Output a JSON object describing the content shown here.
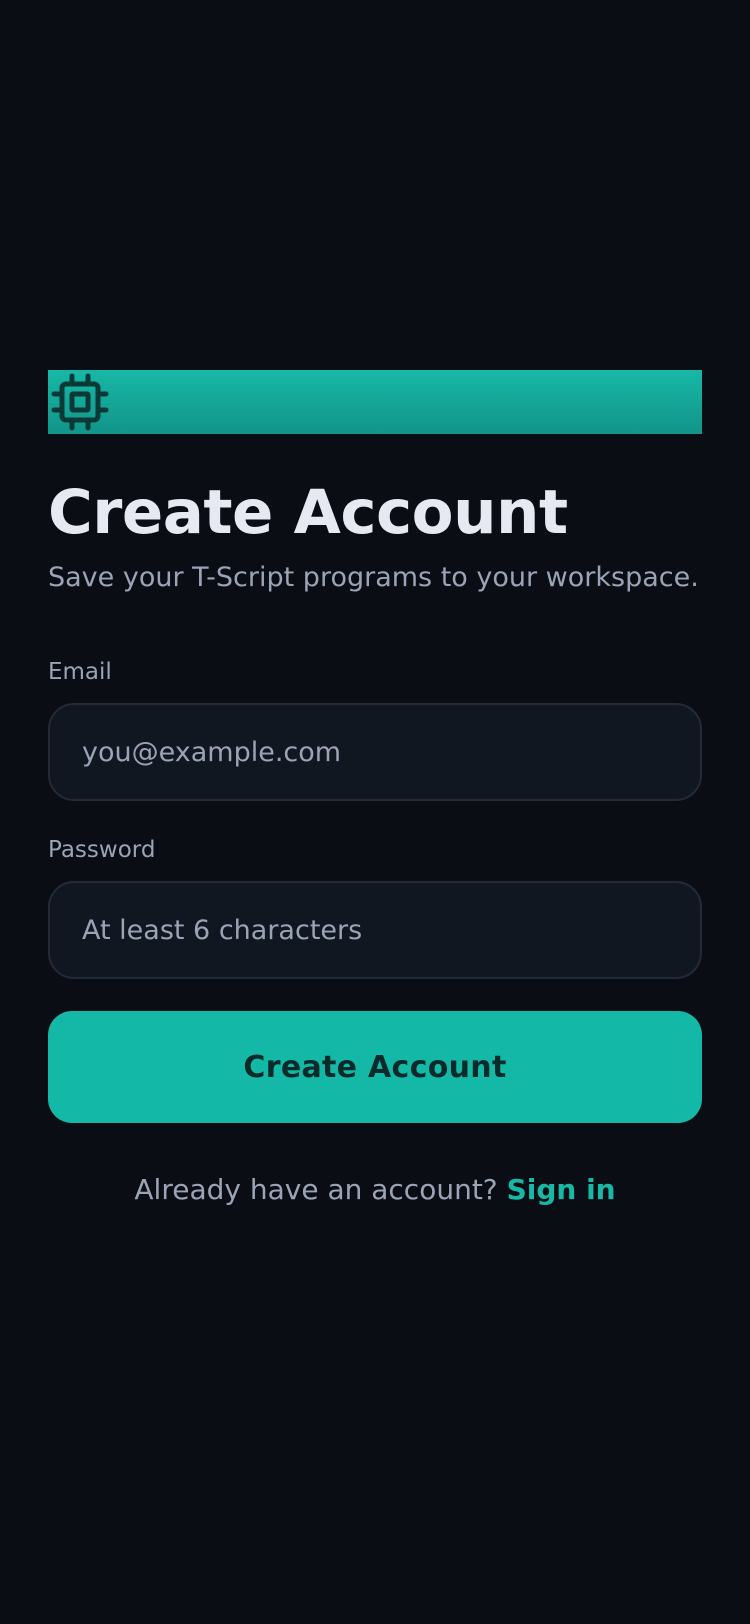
{
  "colors": {
    "background": "#0a0d14",
    "accent": "#14b8a6",
    "muted_text": "#9aa4b6",
    "heading_text": "#e6e9f2",
    "input_background": "#111721"
  },
  "brand": {
    "icon": "cpu-chip-icon"
  },
  "header": {
    "title": "Create Account",
    "subtitle": "Save your T-Script programs to your workspace."
  },
  "form": {
    "email": {
      "label": "Email",
      "placeholder": "you@example.com",
      "value": ""
    },
    "password": {
      "label": "Password",
      "placeholder": "At least 6 characters",
      "value": ""
    },
    "submit_label": "Create Account"
  },
  "footer": {
    "prompt": "Already have an account?",
    "link_label": "Sign in"
  }
}
